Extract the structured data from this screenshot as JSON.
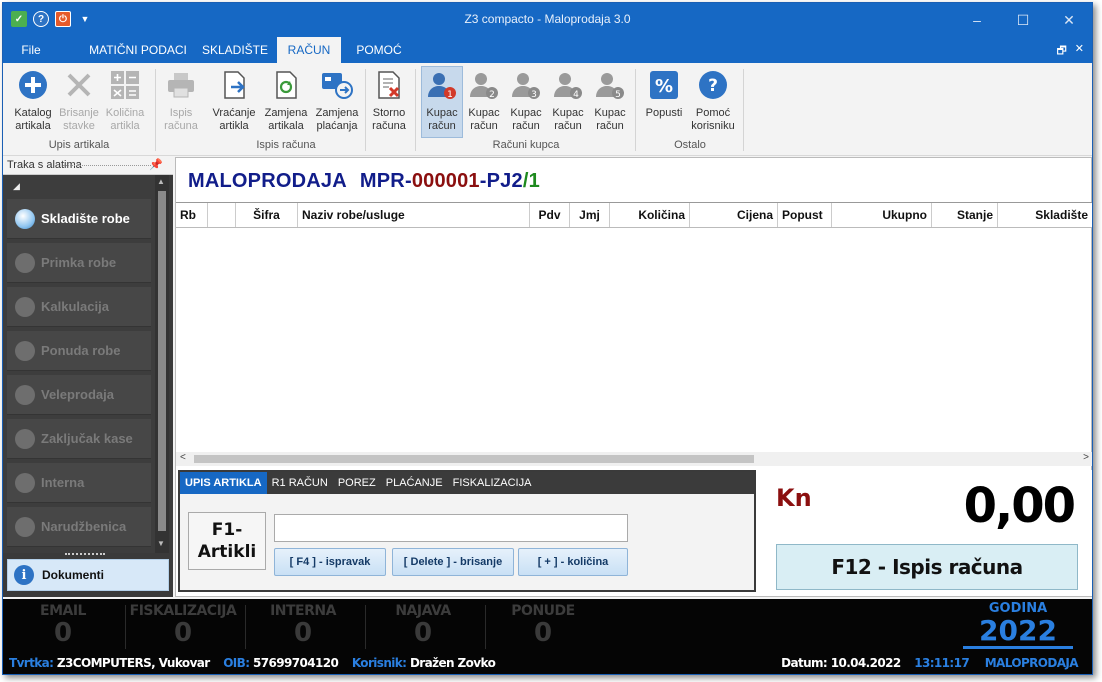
{
  "window": {
    "title": "Z3 compacto - Maloprodaja 3.0"
  },
  "menu": {
    "tabs": [
      "File",
      "MATIČNI PODACI",
      "SKLADIŠTE",
      "RAČUN",
      "POMOĆ"
    ],
    "active": "RAČUN"
  },
  "ribbon": {
    "groups": [
      "Upis artikala",
      "Ispis računa",
      "Računi kupca",
      "Ostalo"
    ],
    "buttons": [
      {
        "label": "Katalog artikala",
        "icon": "plus-circle-icon"
      },
      {
        "label": "Brisanje stavke",
        "icon": "x-icon"
      },
      {
        "label": "Količina artikla",
        "icon": "calculator-icon"
      },
      {
        "label": "Ispis računa",
        "icon": "printer-icon"
      },
      {
        "label": "Vraćanje artikla",
        "icon": "document-return-icon"
      },
      {
        "label": "Zamjena artikala",
        "icon": "document-refresh-icon"
      },
      {
        "label": "Zamjena plaćanja",
        "icon": "payment-swap-icon"
      },
      {
        "label": "Storno računa",
        "icon": "document-cancel-icon"
      },
      {
        "label": "Kupac račun",
        "icon": "customer-1-icon"
      },
      {
        "label": "Kupac račun",
        "icon": "customer-2-icon"
      },
      {
        "label": "Kupac račun",
        "icon": "customer-3-icon"
      },
      {
        "label": "Kupac račun",
        "icon": "customer-4-icon"
      },
      {
        "label": "Kupac račun",
        "icon": "customer-5-icon"
      },
      {
        "label": "Popusti",
        "icon": "percent-icon"
      },
      {
        "label": "Pomoć korisniku",
        "icon": "help-icon"
      }
    ]
  },
  "leftpanel": {
    "header": "Traka s alatima",
    "items": [
      "Skladište robe",
      "Primka robe",
      "Kalkulacija",
      "Ponuda robe",
      "Veleprodaja",
      "Zaključak kase",
      "Interna",
      "Narudžbenica"
    ],
    "active": "Skladište robe",
    "documents": "Dokumenti"
  },
  "document": {
    "type": "MALOPRODAJA",
    "prefix": "MPR-",
    "number": "000001",
    "unit": "-PJ2",
    "suffix": "/1"
  },
  "grid": {
    "columns": [
      "Rb",
      "",
      "Šifra",
      "Naziv robe/usluge",
      "Pdv",
      "Jmj",
      "Količina",
      "Cijena",
      "Popust",
      "Ukupno",
      "Stanje",
      "Skladište"
    ]
  },
  "input": {
    "tabs": [
      "UPIS ARTIKLA",
      "R1 RAČUN",
      "POREZ",
      "PLAĆANJE",
      "FISKALIZACIJA"
    ],
    "f1_line1": "F1-",
    "f1_line2": "Artikli",
    "value": "",
    "buttons": [
      "[ F4 ] - ispravak",
      "[ Delete ] - brisanje",
      "[ + ] - količina"
    ]
  },
  "total": {
    "currency": "Kn",
    "amount": "0,00",
    "print_label": "F12 - Ispis računa"
  },
  "status": {
    "counters": [
      {
        "label": "EMAIL",
        "value": "0"
      },
      {
        "label": "FISKALIZACIJA",
        "value": "0"
      },
      {
        "label": "INTERNA",
        "value": "0"
      },
      {
        "label": "NAJAVA",
        "value": "0"
      },
      {
        "label": "PONUDE",
        "value": "0"
      }
    ],
    "year_label": "GODINA",
    "year": "2022",
    "company_label": "Tvrtka:",
    "company": "Z3COMPUTERS, Vukovar",
    "oib_label": "OIB:",
    "oib": "57699704120",
    "user_label": "Korisnik:",
    "user": "Dražen Zovko",
    "date": "Datum: 10.04.2022",
    "time": "13:11:17",
    "mode": "MALOPRODAJA"
  },
  "colors": {
    "accent": "#1668c4",
    "status_blue": "#2a7fe0",
    "doc_title": "#111d8a",
    "doc_number": "#8b0f0f",
    "doc_suffix": "#1e8a1e"
  }
}
